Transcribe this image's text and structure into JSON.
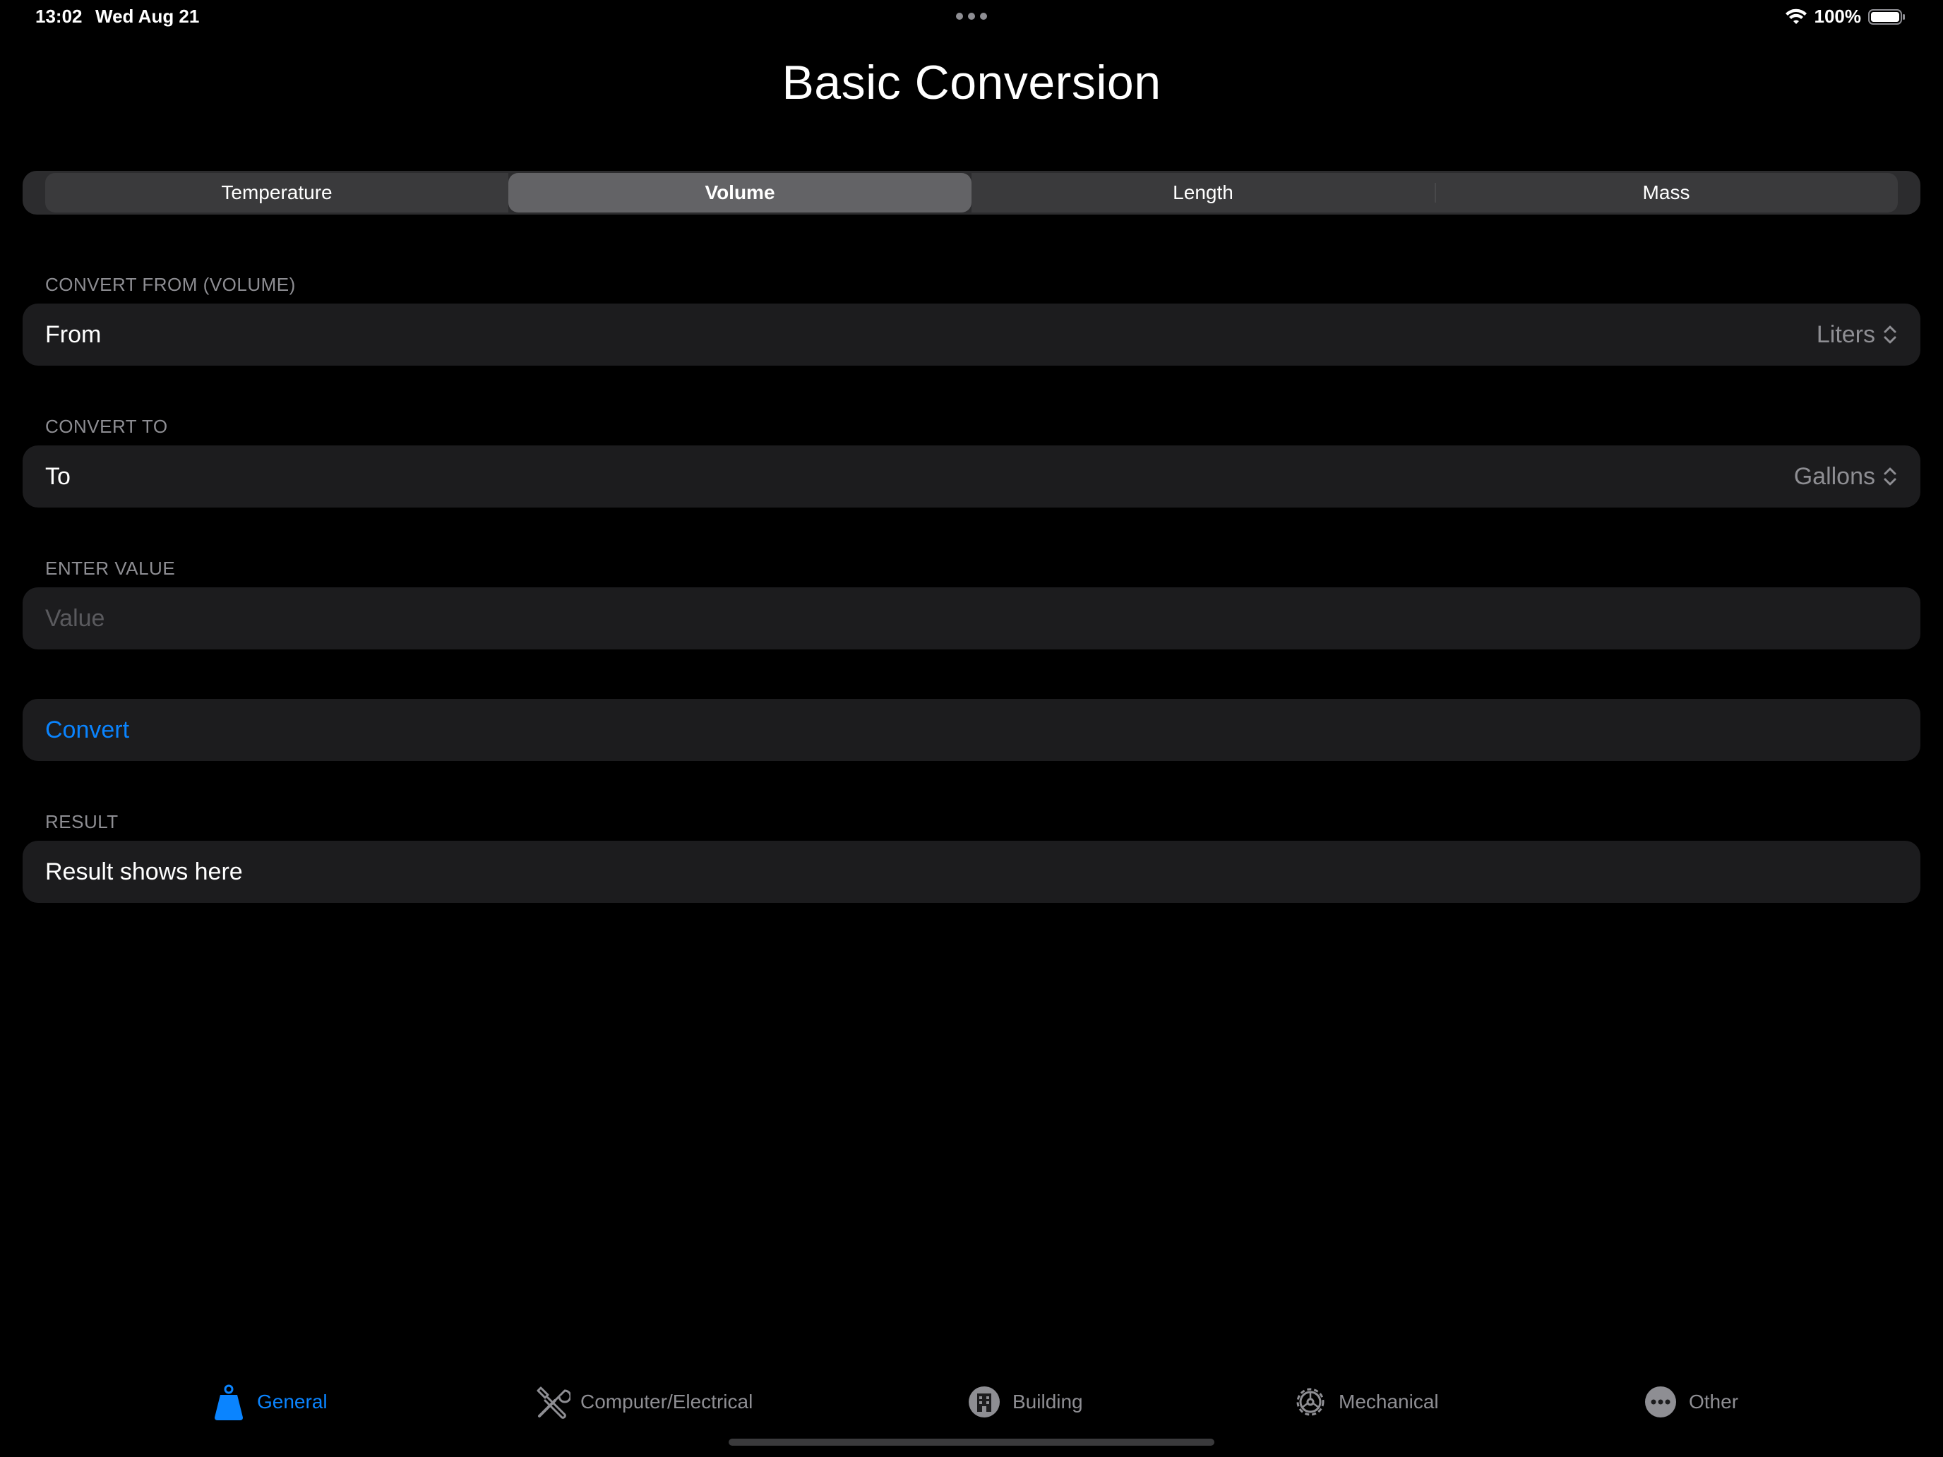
{
  "status_bar": {
    "time": "13:02",
    "date": "Wed Aug 21",
    "battery": "100%"
  },
  "title": "Basic Conversion",
  "segments": {
    "items": [
      "Temperature",
      "Volume",
      "Length",
      "Mass"
    ],
    "selected": "Volume"
  },
  "convert_from": {
    "header": "CONVERT FROM (VOLUME)",
    "label": "From",
    "value": "Liters"
  },
  "convert_to": {
    "header": "CONVERT TO",
    "label": "To",
    "value": "Gallons"
  },
  "enter_value": {
    "header": "ENTER VALUE",
    "placeholder": "Value"
  },
  "convert_button": {
    "label": "Convert"
  },
  "result": {
    "header": "RESULT",
    "text": "Result shows here"
  },
  "tab_bar": {
    "items": [
      {
        "label": "General",
        "icon": "weight-icon",
        "active": true
      },
      {
        "label": "Computer/Electrical",
        "icon": "tools-icon",
        "active": false
      },
      {
        "label": "Building",
        "icon": "building-icon",
        "active": false
      },
      {
        "label": "Mechanical",
        "icon": "gear-icon",
        "active": false
      },
      {
        "label": "Other",
        "icon": "more-icon",
        "active": false
      }
    ]
  },
  "colors": {
    "accent": "#0a84ff",
    "background": "#000000",
    "row_background": "#1c1c1e",
    "secondary_text": "#8e8e93"
  }
}
